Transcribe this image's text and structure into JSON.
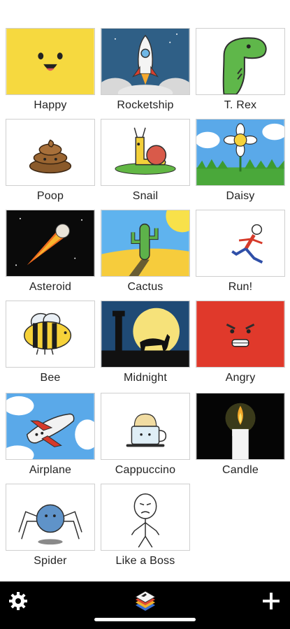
{
  "tiles": [
    {
      "label": "Happy"
    },
    {
      "label": "Rocketship"
    },
    {
      "label": "T. Rex"
    },
    {
      "label": "Poop"
    },
    {
      "label": "Snail"
    },
    {
      "label": "Daisy"
    },
    {
      "label": "Asteroid"
    },
    {
      "label": "Cactus"
    },
    {
      "label": "Run!"
    },
    {
      "label": "Bee"
    },
    {
      "label": "Midnight"
    },
    {
      "label": "Angry"
    },
    {
      "label": "Airplane"
    },
    {
      "label": "Cappuccino"
    },
    {
      "label": "Candle"
    },
    {
      "label": "Spider"
    },
    {
      "label": "Like a Boss"
    }
  ],
  "toolbar": {
    "settings_icon": "gear-icon",
    "app_icon": "flipbook-icon",
    "add_icon": "plus-icon"
  },
  "colors": {
    "toolbar_bg": "#000000",
    "happy_bg": "#f6d93f",
    "angry_bg": "#e0392b"
  }
}
